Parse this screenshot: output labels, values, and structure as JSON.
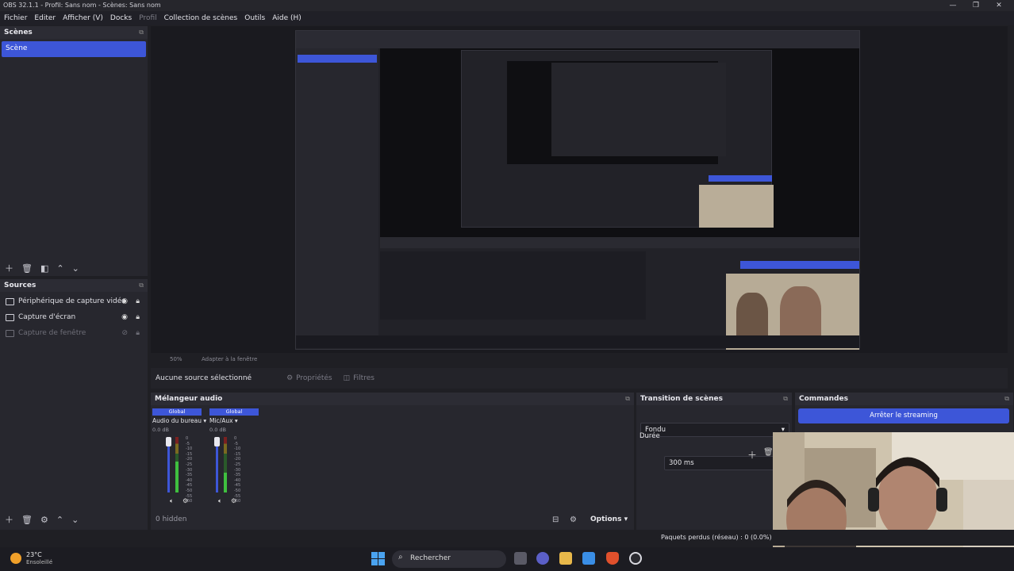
{
  "window": {
    "title": "OBS 32.1.1 - Profil: Sans nom - Scènes: Sans nom",
    "minimize": "—",
    "maximize": "❐",
    "close": "✕"
  },
  "menu": [
    "Fichier",
    "Editer",
    "Afficher (V)",
    "Docks",
    "Profil",
    "Collection de scènes",
    "Outils",
    "Aide (H)"
  ],
  "scenes": {
    "title": "Scènes",
    "items": [
      "Scène"
    ]
  },
  "sources": {
    "title": "Sources",
    "items": [
      {
        "label": "Périphérique de capture vidéo",
        "icon": "camera-icon",
        "visible": true
      },
      {
        "label": "Capture d'écran",
        "icon": "monitor-icon",
        "visible": true
      },
      {
        "label": "Capture de fenêtre",
        "icon": "window-icon",
        "visible": false
      }
    ]
  },
  "source_toolbar": {
    "no_source": "Aucune source sélectionné",
    "properties": "Propriétés",
    "filters": "Filtres"
  },
  "below_preview": {
    "zoom": "50%",
    "fit": "Adapter à la fenêtre"
  },
  "mixer": {
    "title": "Mélangeur audio",
    "channels": [
      {
        "badge": "Global",
        "name": "Audio du bureau",
        "db": "0.0 dB",
        "level": 0.55
      },
      {
        "badge": "Global",
        "name": "Mic/Aux",
        "db": "0.0 dB",
        "level": 0.35
      }
    ],
    "scale": [
      "0",
      "-5",
      "-10",
      "-15",
      "-20",
      "-25",
      "-30",
      "-35",
      "-40",
      "-45",
      "-50",
      "-55",
      "-60"
    ],
    "hidden": "0 hidden",
    "options": "Options"
  },
  "transitions": {
    "title": "Transition de scènes",
    "selected": "Fondu",
    "duration_label": "Durée",
    "duration_value": "300 ms"
  },
  "commands": {
    "title": "Commandes",
    "stop_stream": "Arrêter le streaming"
  },
  "status": {
    "dropped": "Paquets perdus (réseau) : 0 (0.0%)"
  },
  "taskbar": {
    "temp": "23°C",
    "weather": "Ensoleillé",
    "search": "Rechercher"
  },
  "colors": {
    "accent": "#3d56d8",
    "background": "#1f1f24",
    "dock": "#27272e"
  }
}
